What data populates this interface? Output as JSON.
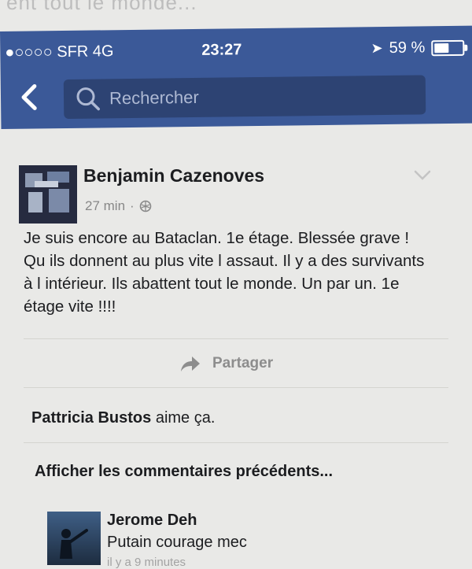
{
  "background_text": "ent tout le monde...",
  "status_bar": {
    "carrier": "●○○○○ SFR  4G",
    "time": "23:27",
    "battery_percent": "59 %",
    "battery_level": 0.59
  },
  "search": {
    "placeholder": "Rechercher"
  },
  "post": {
    "author": "Benjamin Cazenoves",
    "time": "27 min",
    "separator": "·",
    "text": "Je suis encore au Bataclan. 1e étage. Blessée grave ! Qu ils donnent au plus vite l assaut. Il y a des survivants à l intérieur. Ils abattent tout le monde. Un par un. 1e étage vite !!!!",
    "share_label": "Partager"
  },
  "likes": {
    "name": "Pattricia Bustos",
    "suffix": " aime ça."
  },
  "previous_comments_label": "Afficher les commentaires précédents...",
  "comment": {
    "author": "Jerome Deh",
    "text": "Putain courage mec",
    "time": "il y a 9 minutes"
  },
  "colors": {
    "header": "#3b5998",
    "search_bg": "#2d4373",
    "background": "#e9e9e7"
  }
}
